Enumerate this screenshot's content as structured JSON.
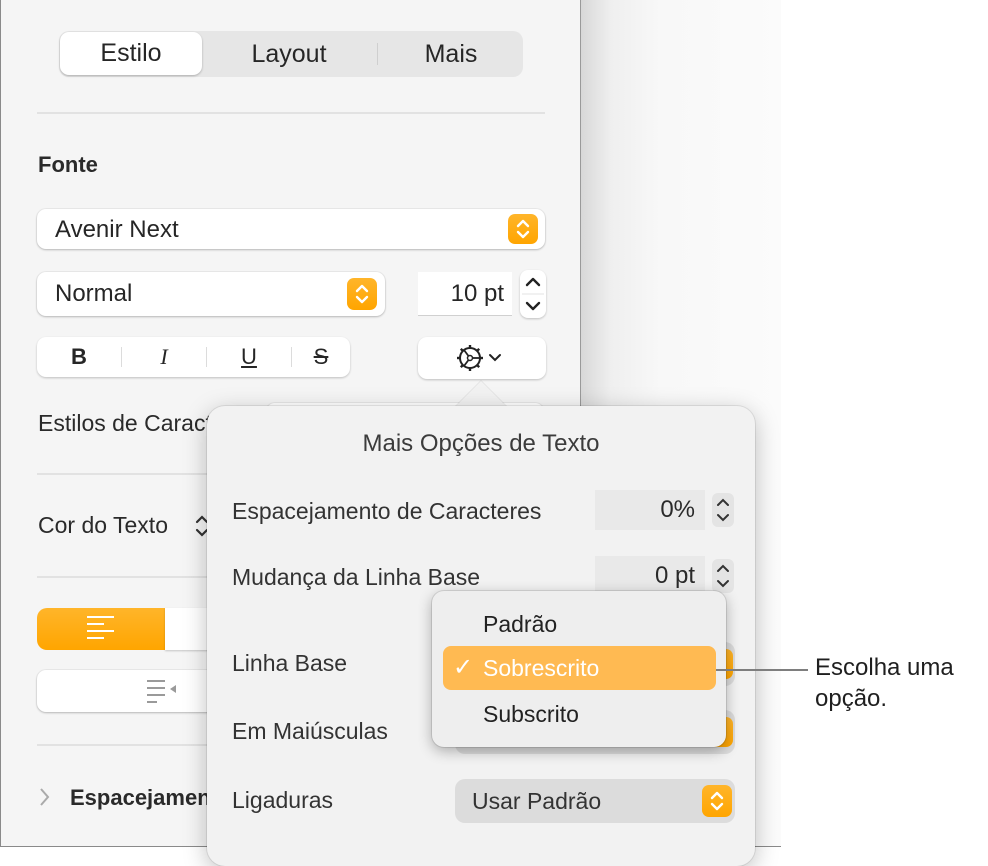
{
  "tabs": [
    {
      "label": "Estilo",
      "active": true
    },
    {
      "label": "Layout",
      "active": false
    },
    {
      "label": "Mais",
      "active": false
    }
  ],
  "font_section": {
    "heading": "Fonte",
    "font_family": "Avenir Next",
    "typeface": "Normal",
    "size": "10 pt",
    "style_buttons": [
      {
        "name": "bold",
        "glyph": "B"
      },
      {
        "name": "italic",
        "glyph": "I"
      },
      {
        "name": "underline",
        "glyph": "U"
      },
      {
        "name": "strikethrough",
        "glyph": "S"
      }
    ],
    "advanced_options_icon": "gear-icon"
  },
  "character_styles_label": "Estilos de Caracteres",
  "text_color_label": "Cor do Texto",
  "alignment": {
    "selected": "left",
    "indent_icon": "decrease-indent-icon"
  },
  "spacing_section": {
    "label": "Espacejamento",
    "expanded": false
  },
  "popover": {
    "title": "Mais Opções de Texto",
    "rows": [
      {
        "label": "Espacejamento de Caracteres",
        "value": "0%"
      },
      {
        "label": "Mudança da Linha Base",
        "value": "0 pt"
      },
      {
        "label": "Linha Base"
      },
      {
        "label": "Em Maiúsculas"
      },
      {
        "label": "Ligaduras",
        "value": "Usar Padrão"
      }
    ]
  },
  "baseline_menu": {
    "items": [
      {
        "label": "Padrão",
        "selected": false
      },
      {
        "label": "Sobrescrito",
        "selected": true
      },
      {
        "label": "Subscrito",
        "selected": false
      }
    ],
    "check_glyph": "✓"
  },
  "callout": {
    "line1": "Escolha uma",
    "line2": "opção."
  },
  "colors": {
    "accent": "#ffa500",
    "menu_highlight": "#ffba52"
  }
}
